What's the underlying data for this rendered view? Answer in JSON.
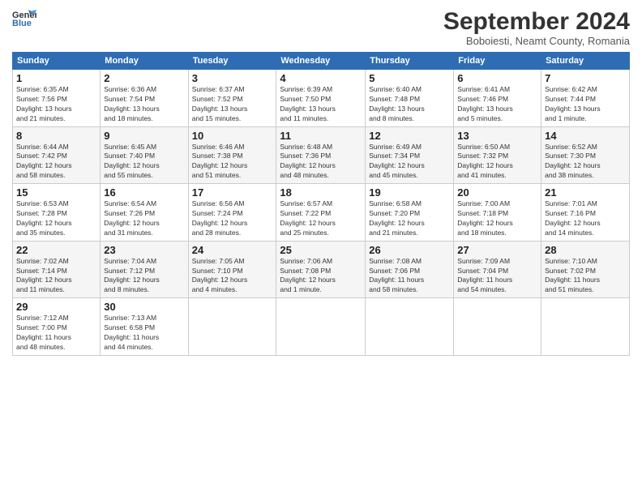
{
  "header": {
    "logo_line1": "General",
    "logo_line2": "Blue",
    "month": "September 2024",
    "location": "Boboiesti, Neamt County, Romania"
  },
  "weekdays": [
    "Sunday",
    "Monday",
    "Tuesday",
    "Wednesday",
    "Thursday",
    "Friday",
    "Saturday"
  ],
  "weeks": [
    [
      {
        "day": "1",
        "info": "Sunrise: 6:35 AM\nSunset: 7:56 PM\nDaylight: 13 hours\nand 21 minutes."
      },
      {
        "day": "2",
        "info": "Sunrise: 6:36 AM\nSunset: 7:54 PM\nDaylight: 13 hours\nand 18 minutes."
      },
      {
        "day": "3",
        "info": "Sunrise: 6:37 AM\nSunset: 7:52 PM\nDaylight: 13 hours\nand 15 minutes."
      },
      {
        "day": "4",
        "info": "Sunrise: 6:39 AM\nSunset: 7:50 PM\nDaylight: 13 hours\nand 11 minutes."
      },
      {
        "day": "5",
        "info": "Sunrise: 6:40 AM\nSunset: 7:48 PM\nDaylight: 13 hours\nand 8 minutes."
      },
      {
        "day": "6",
        "info": "Sunrise: 6:41 AM\nSunset: 7:46 PM\nDaylight: 13 hours\nand 5 minutes."
      },
      {
        "day": "7",
        "info": "Sunrise: 6:42 AM\nSunset: 7:44 PM\nDaylight: 13 hours\nand 1 minute."
      }
    ],
    [
      {
        "day": "8",
        "info": "Sunrise: 6:44 AM\nSunset: 7:42 PM\nDaylight: 12 hours\nand 58 minutes."
      },
      {
        "day": "9",
        "info": "Sunrise: 6:45 AM\nSunset: 7:40 PM\nDaylight: 12 hours\nand 55 minutes."
      },
      {
        "day": "10",
        "info": "Sunrise: 6:46 AM\nSunset: 7:38 PM\nDaylight: 12 hours\nand 51 minutes."
      },
      {
        "day": "11",
        "info": "Sunrise: 6:48 AM\nSunset: 7:36 PM\nDaylight: 12 hours\nand 48 minutes."
      },
      {
        "day": "12",
        "info": "Sunrise: 6:49 AM\nSunset: 7:34 PM\nDaylight: 12 hours\nand 45 minutes."
      },
      {
        "day": "13",
        "info": "Sunrise: 6:50 AM\nSunset: 7:32 PM\nDaylight: 12 hours\nand 41 minutes."
      },
      {
        "day": "14",
        "info": "Sunrise: 6:52 AM\nSunset: 7:30 PM\nDaylight: 12 hours\nand 38 minutes."
      }
    ],
    [
      {
        "day": "15",
        "info": "Sunrise: 6:53 AM\nSunset: 7:28 PM\nDaylight: 12 hours\nand 35 minutes."
      },
      {
        "day": "16",
        "info": "Sunrise: 6:54 AM\nSunset: 7:26 PM\nDaylight: 12 hours\nand 31 minutes."
      },
      {
        "day": "17",
        "info": "Sunrise: 6:56 AM\nSunset: 7:24 PM\nDaylight: 12 hours\nand 28 minutes."
      },
      {
        "day": "18",
        "info": "Sunrise: 6:57 AM\nSunset: 7:22 PM\nDaylight: 12 hours\nand 25 minutes."
      },
      {
        "day": "19",
        "info": "Sunrise: 6:58 AM\nSunset: 7:20 PM\nDaylight: 12 hours\nand 21 minutes."
      },
      {
        "day": "20",
        "info": "Sunrise: 7:00 AM\nSunset: 7:18 PM\nDaylight: 12 hours\nand 18 minutes."
      },
      {
        "day": "21",
        "info": "Sunrise: 7:01 AM\nSunset: 7:16 PM\nDaylight: 12 hours\nand 14 minutes."
      }
    ],
    [
      {
        "day": "22",
        "info": "Sunrise: 7:02 AM\nSunset: 7:14 PM\nDaylight: 12 hours\nand 11 minutes."
      },
      {
        "day": "23",
        "info": "Sunrise: 7:04 AM\nSunset: 7:12 PM\nDaylight: 12 hours\nand 8 minutes."
      },
      {
        "day": "24",
        "info": "Sunrise: 7:05 AM\nSunset: 7:10 PM\nDaylight: 12 hours\nand 4 minutes."
      },
      {
        "day": "25",
        "info": "Sunrise: 7:06 AM\nSunset: 7:08 PM\nDaylight: 12 hours\nand 1 minute."
      },
      {
        "day": "26",
        "info": "Sunrise: 7:08 AM\nSunset: 7:06 PM\nDaylight: 11 hours\nand 58 minutes."
      },
      {
        "day": "27",
        "info": "Sunrise: 7:09 AM\nSunset: 7:04 PM\nDaylight: 11 hours\nand 54 minutes."
      },
      {
        "day": "28",
        "info": "Sunrise: 7:10 AM\nSunset: 7:02 PM\nDaylight: 11 hours\nand 51 minutes."
      }
    ],
    [
      {
        "day": "29",
        "info": "Sunrise: 7:12 AM\nSunset: 7:00 PM\nDaylight: 11 hours\nand 48 minutes."
      },
      {
        "day": "30",
        "info": "Sunrise: 7:13 AM\nSunset: 6:58 PM\nDaylight: 11 hours\nand 44 minutes."
      },
      {
        "day": "",
        "info": ""
      },
      {
        "day": "",
        "info": ""
      },
      {
        "day": "",
        "info": ""
      },
      {
        "day": "",
        "info": ""
      },
      {
        "day": "",
        "info": ""
      }
    ]
  ]
}
